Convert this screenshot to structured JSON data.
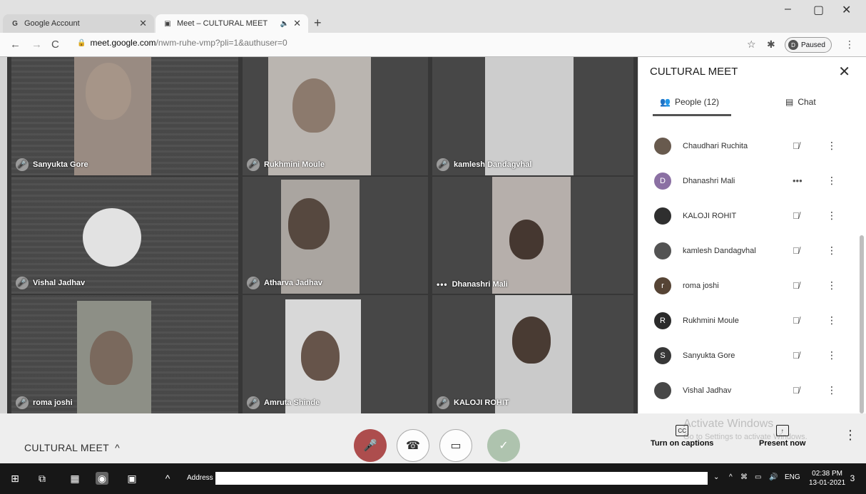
{
  "browser": {
    "tabs": [
      {
        "title": "Google Account",
        "favicon": "G",
        "active": false
      },
      {
        "title": "Meet – CULTURAL MEET",
        "favicon": "meet",
        "active": true
      }
    ],
    "url_host": "meet.google.com",
    "url_path": "/nwm-ruhe-vmp?pli=1&authuser=0",
    "profile_label": "Paused",
    "profile_initial": "D"
  },
  "participants_tiles": [
    {
      "name": "Sanyukta Gore",
      "status": "muted"
    },
    {
      "name": "Rukhmini Moule",
      "status": "muted"
    },
    {
      "name": "kamlesh Dandagvhal",
      "status": "muted"
    },
    {
      "name": "Vishal Jadhav",
      "status": "muted"
    },
    {
      "name": "Atharva Jadhav",
      "status": "muted"
    },
    {
      "name": "Dhanashri Mali",
      "status": "speaking"
    },
    {
      "name": "roma joshi",
      "status": "muted"
    },
    {
      "name": "Amruta Shinde",
      "status": "muted"
    },
    {
      "name": "KALOJI ROHIT",
      "status": "muted"
    }
  ],
  "panel": {
    "title": "CULTURAL MEET",
    "people_tab": "People (12)",
    "chat_tab": "Chat",
    "people": [
      {
        "name": "Chaudhari Ruchita",
        "initial": "",
        "color": "#6b5b4e",
        "status": "muted"
      },
      {
        "name": "Dhanashri Mali",
        "initial": "D",
        "color": "#8d6fa8",
        "status": "speaking"
      },
      {
        "name": "KALOJI ROHIT",
        "initial": "",
        "color": "#333333",
        "status": "muted"
      },
      {
        "name": "kamlesh Dandagvhal",
        "initial": "",
        "color": "#555555",
        "status": "muted"
      },
      {
        "name": "roma joshi",
        "initial": "r",
        "color": "#5b4636",
        "status": "muted"
      },
      {
        "name": "Rukhmini Moule",
        "initial": "R",
        "color": "#2f2f2f",
        "status": "muted"
      },
      {
        "name": "Sanyukta Gore",
        "initial": "S",
        "color": "#3a3a3a",
        "status": "muted"
      },
      {
        "name": "Vishal Jadhav",
        "initial": "",
        "color": "#4a4a4a",
        "status": "muted"
      }
    ]
  },
  "bottombar": {
    "meeting_name": "CULTURAL MEET",
    "captions_label": "Turn on captions",
    "present_label": "Present now",
    "activate_line1": "Activate Windows",
    "activate_line2": "Go to Settings to activate Windows."
  },
  "taskbar": {
    "address_label": "Address",
    "language": "ENG",
    "time": "02:38 PM",
    "date": "13-01-2021",
    "notification_count": "3"
  }
}
